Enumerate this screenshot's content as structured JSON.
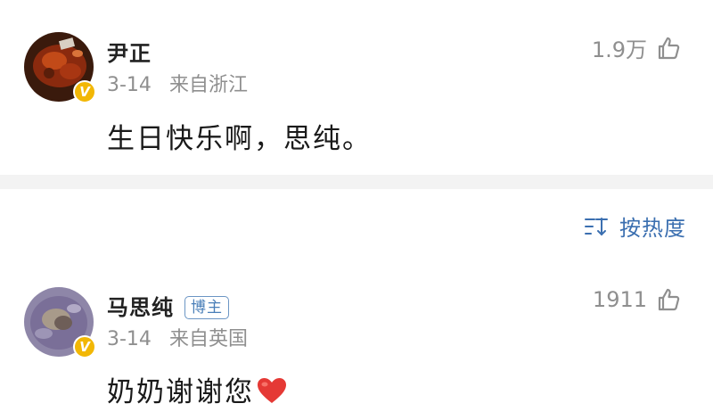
{
  "comments": [
    {
      "username": "尹正",
      "date": "3-14",
      "location": "来自浙江",
      "text": "生日快乐啊，思纯。",
      "likes": "1.9万",
      "verified_badge": "V"
    },
    {
      "username": "马思纯",
      "role_badge": "博主",
      "date": "3-14",
      "location": "来自英国",
      "text": "奶奶谢谢您",
      "text_emoji": "❤",
      "likes": "1911",
      "verified_badge": "V"
    }
  ],
  "sort": {
    "label": "按热度",
    "icon": "sort-icon"
  },
  "colors": {
    "verified": "#f2b705",
    "link": "#3b6fb0",
    "meta": "#8f8f8f",
    "heart": "#e53935"
  }
}
